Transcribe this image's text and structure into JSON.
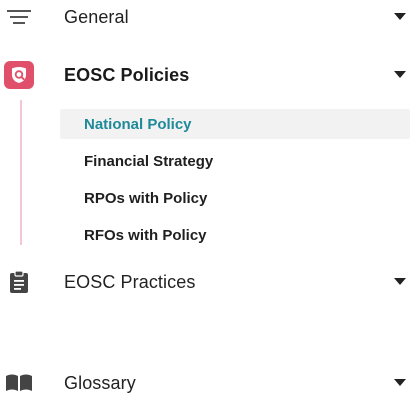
{
  "menu": {
    "general": {
      "label": "General",
      "icon": "menu-lines-icon",
      "expanded": false
    },
    "policies": {
      "label": "EOSC Policies",
      "icon": "shield-search-icon",
      "expanded": true,
      "accent_color": "#e0506a",
      "items": [
        {
          "label": "National Policy",
          "active": true
        },
        {
          "label": "Financial Strategy",
          "active": false
        },
        {
          "label": "RPOs with Policy",
          "active": false
        },
        {
          "label": "RFOs with Policy",
          "active": false
        }
      ]
    },
    "practices": {
      "label": "EOSC Practices",
      "icon": "clipboard-icon",
      "expanded": false
    },
    "glossary": {
      "label": "Glossary",
      "icon": "book-icon",
      "expanded": false
    }
  },
  "colors": {
    "active_text": "#1f8a99",
    "active_bg": "#f2f2f2",
    "submenu_rail": "#f0c7d3"
  }
}
